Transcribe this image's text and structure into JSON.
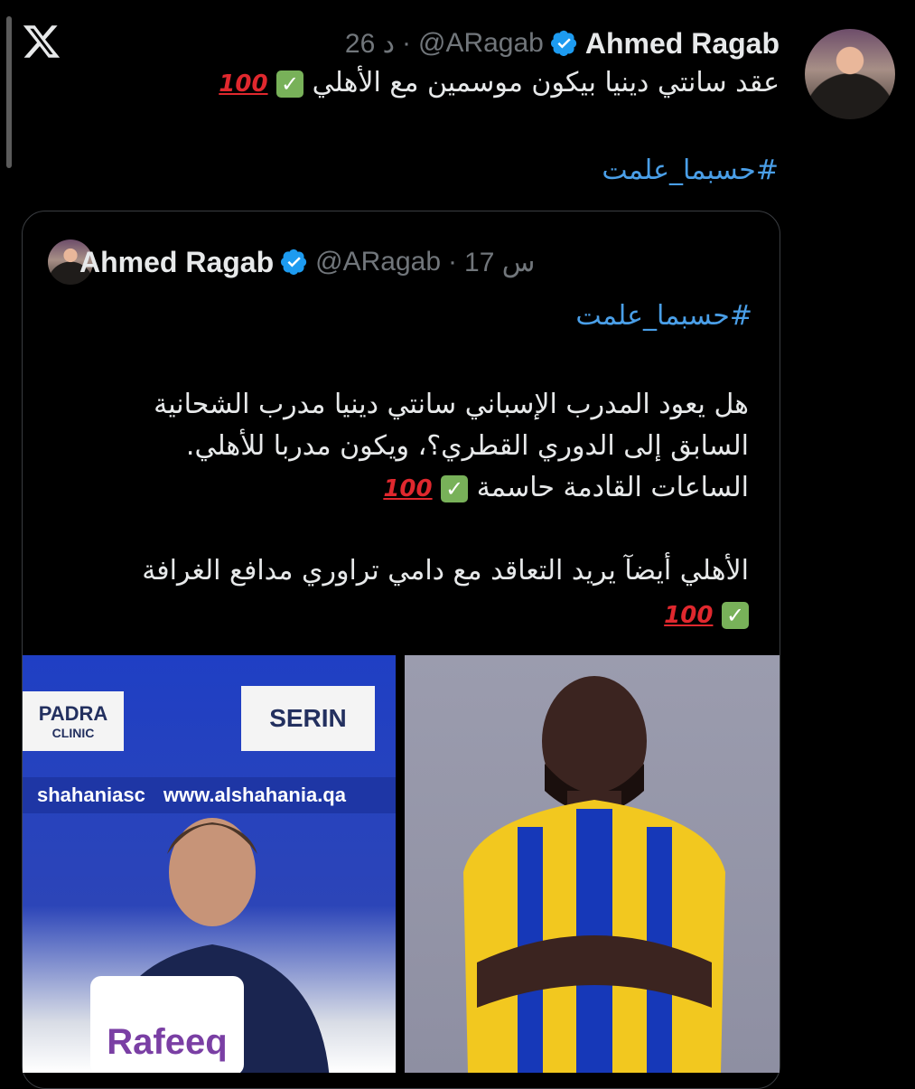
{
  "app": {
    "logo_icon": "x-logo-icon"
  },
  "tweet": {
    "author_name": "Ahmed Ragab",
    "handle": "@ARagab",
    "separator": "·",
    "time": "26 د",
    "text": "عقد سانتي دينيا بيكون موسمين مع الأهلي",
    "emoji_check": "✓",
    "emoji_100": "100",
    "hashtag": "#حسبما_علمت"
  },
  "quote": {
    "author_name": "Ahmed Ragab",
    "handle": "@ARagab",
    "separator": "·",
    "time": "17 س",
    "hashtag": "#حسبما_علمت",
    "line1": "هل يعود المدرب الإسباني سانتي دينيا مدرب الشحانية",
    "line2": "السابق إلى الدوري القطري؟، ويكون مدربا للأهلي.",
    "line3": "الساعات القادمة حاسمة",
    "line4": "الأهلي أيضآ يريد التعاقد مع دامي تراوري مدافع الغرافة",
    "emoji_check": "✓",
    "emoji_100": "100"
  },
  "images": {
    "left": {
      "sponsor_padra": "PADRA",
      "sponsor_clinic": "CLINIC",
      "sponsor_serin": "SERIN",
      "social_handle": "shahaniasc",
      "website": "www.alshahania.qa",
      "rafeeq": "Rafeeq"
    }
  },
  "colors": {
    "accent": "#4a9fe8",
    "verified": "#1d9bf0",
    "muted": "#71767b",
    "background": "#000000"
  }
}
